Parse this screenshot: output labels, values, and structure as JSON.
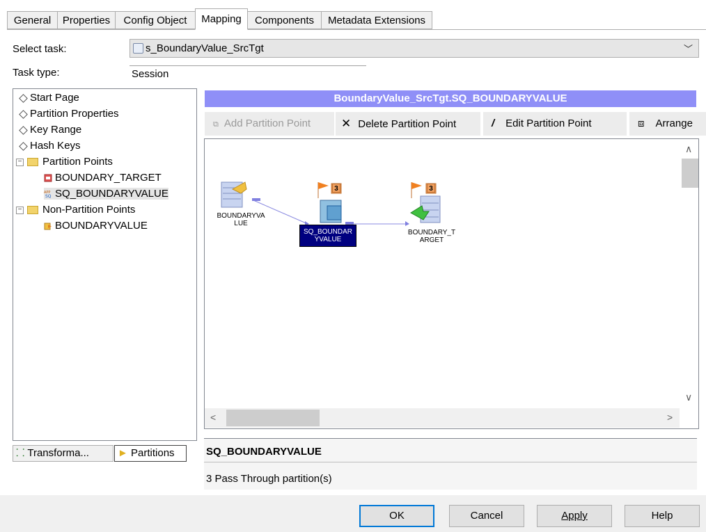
{
  "tabs": [
    {
      "label": "General"
    },
    {
      "label": "Properties"
    },
    {
      "label": "Config Object"
    },
    {
      "label": "Mapping"
    },
    {
      "label": "Components"
    },
    {
      "label": "Metadata Extensions"
    }
  ],
  "select_task": {
    "label": "Select task:",
    "value": "s_BoundaryValue_SrcTgt"
  },
  "task_type": {
    "label": "Task type:",
    "value": "Session"
  },
  "tree": {
    "items": [
      {
        "label": "Start Page"
      },
      {
        "label": "Partition Properties"
      },
      {
        "label": "Key Range"
      },
      {
        "label": "Hash Keys"
      },
      {
        "label": "Partition Points"
      },
      {
        "label": "BOUNDARY_TARGET"
      },
      {
        "label": "SQ_BOUNDARYVALUE"
      },
      {
        "label": "Non-Partition Points"
      },
      {
        "label": "BOUNDARYVALUE"
      }
    ]
  },
  "bottom_tabs": [
    {
      "label": "Transforma..."
    },
    {
      "label": "Partitions"
    }
  ],
  "panel_title": "BoundaryValue_SrcTgt.SQ_BOUNDARYVALUE",
  "toolbar": {
    "add": "Add Partition Point",
    "delete": "Delete Partition Point",
    "edit": "Edit Partition Point",
    "arrange": "Arrange"
  },
  "diagram": {
    "source": {
      "label_line1": "BOUNDARYVA",
      "label_line2": "LUE"
    },
    "sq": {
      "label_line1": "SQ_BOUNDAR",
      "label_line2": "YVALUE",
      "partitions": "3"
    },
    "target": {
      "label_line1": "BOUNDARY_T",
      "label_line2": "ARGET",
      "partitions": "3"
    }
  },
  "info": {
    "title": "SQ_BOUNDARYVALUE",
    "text": "3 Pass Through partition(s)"
  },
  "footer": {
    "ok": "OK",
    "cancel": "Cancel",
    "apply": "Apply",
    "help": "Help"
  },
  "colors": {
    "title_bar": "#8f8ff7",
    "selected_node": "#000080",
    "default_button_border": "#0078d7"
  }
}
